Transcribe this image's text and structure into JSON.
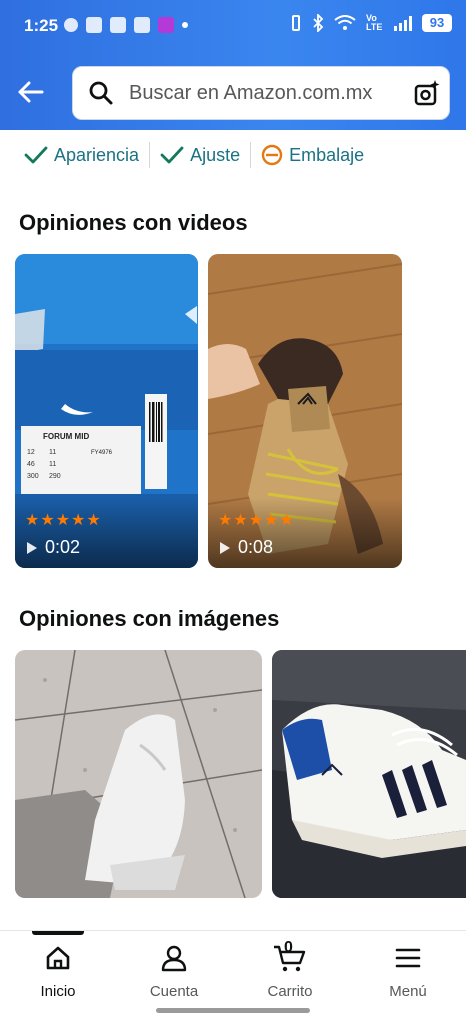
{
  "status_bar": {
    "time": "1:25",
    "network_label": "Vo LTE",
    "battery": "93"
  },
  "search": {
    "placeholder": "Buscar en Amazon.com.mx"
  },
  "chips": [
    {
      "label": "Apariencia",
      "icon": "check-icon",
      "color": "#127a5a"
    },
    {
      "label": "Ajuste",
      "icon": "check-icon",
      "color": "#127a5a"
    },
    {
      "label": "Embalaje",
      "icon": "minus-circle-icon",
      "color": "#e47911"
    }
  ],
  "sections": {
    "videos_title": "Opiniones con videos",
    "images_title": "Opiniones con imágenes"
  },
  "videos": [
    {
      "stars": "★★★★★",
      "duration": "0:02",
      "subject": "shoe-box"
    },
    {
      "stars": "★★★★★",
      "duration": "0:08",
      "subject": "sneaker"
    }
  ],
  "box_label": {
    "model": "FORUM MID",
    "code": "FY4976",
    "sizes": [
      [
        "12",
        "11"
      ],
      [
        "46",
        "11"
      ],
      [
        "300",
        "290"
      ]
    ]
  },
  "nav": {
    "items": [
      {
        "label": "Inicio",
        "icon": "home-icon"
      },
      {
        "label": "Cuenta",
        "icon": "user-icon"
      },
      {
        "label": "Carrito",
        "icon": "cart-icon",
        "badge": "0"
      },
      {
        "label": "Menú",
        "icon": "menu-icon"
      }
    ]
  },
  "colors": {
    "header_blue": "#2f77ea",
    "star_orange": "#ff7a00",
    "chip_teal": "#1a7285"
  }
}
